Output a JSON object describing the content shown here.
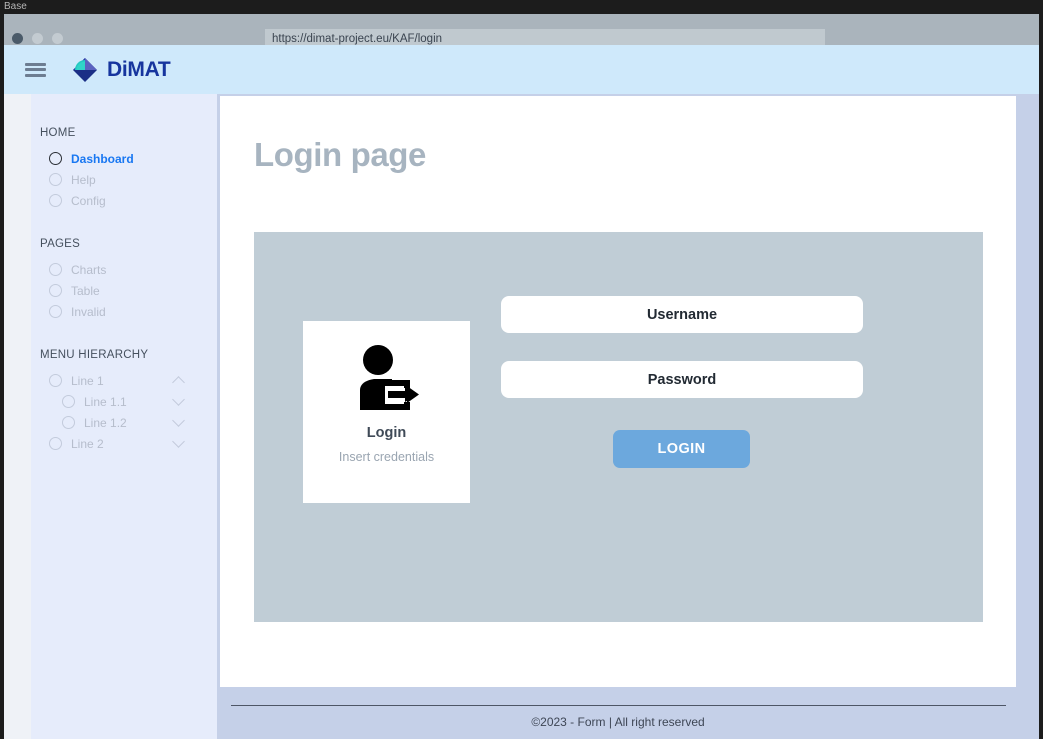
{
  "window": {
    "title": "Base",
    "traffic_lights": [
      "close-dot",
      "minimize-dot",
      "maximize-dot"
    ]
  },
  "browser": {
    "url": "https://dimat-project.eu/KAF/login"
  },
  "header": {
    "menu_icon": "hamburger-icon",
    "brand_icon": "dimat-diamond-logo",
    "brand_text": "DiMAT"
  },
  "sidebar": {
    "groups": [
      {
        "title": "HOME",
        "items": [
          {
            "label": "Dashboard",
            "active": true,
            "indent": false,
            "chevron": ""
          },
          {
            "label": "Help",
            "active": false,
            "indent": false,
            "chevron": ""
          },
          {
            "label": "Config",
            "active": false,
            "indent": false,
            "chevron": ""
          }
        ]
      },
      {
        "title": "PAGES",
        "items": [
          {
            "label": "Charts",
            "active": false,
            "indent": false,
            "chevron": ""
          },
          {
            "label": "Table",
            "active": false,
            "indent": false,
            "chevron": ""
          },
          {
            "label": "Invalid",
            "active": false,
            "indent": false,
            "chevron": ""
          }
        ]
      },
      {
        "title": "MENU HIERARCHY",
        "items": [
          {
            "label": "Line 1",
            "active": false,
            "indent": false,
            "chevron": "up"
          },
          {
            "label": "Line 1.1",
            "active": false,
            "indent": true,
            "chevron": "down"
          },
          {
            "label": "Line 1.2",
            "active": false,
            "indent": true,
            "chevron": "down"
          },
          {
            "label": "Line 2",
            "active": false,
            "indent": false,
            "chevron": "down"
          }
        ]
      }
    ]
  },
  "main": {
    "page_title": "Login page",
    "login_card": {
      "icon": "user-sign-in-icon",
      "title": "Login",
      "subtitle": "Insert credentials"
    },
    "form": {
      "username_value": "Username",
      "username_placeholder": "Username",
      "password_value": "Password",
      "password_placeholder": "Password",
      "submit_label": "LOGIN"
    }
  },
  "footer": {
    "text": "©2023 - Form  |   All right reserved"
  },
  "colors": {
    "header_bg": "#cfe9fb",
    "sidebar_bg": "#e6ecfb",
    "page_bg": "#c5d0e8",
    "panel_bg": "#c0cdd6",
    "accent_blue": "#1877f2",
    "button_blue": "#6ca8dd",
    "brand_blue": "#17359e",
    "title_gray": "#a7b4c0"
  }
}
